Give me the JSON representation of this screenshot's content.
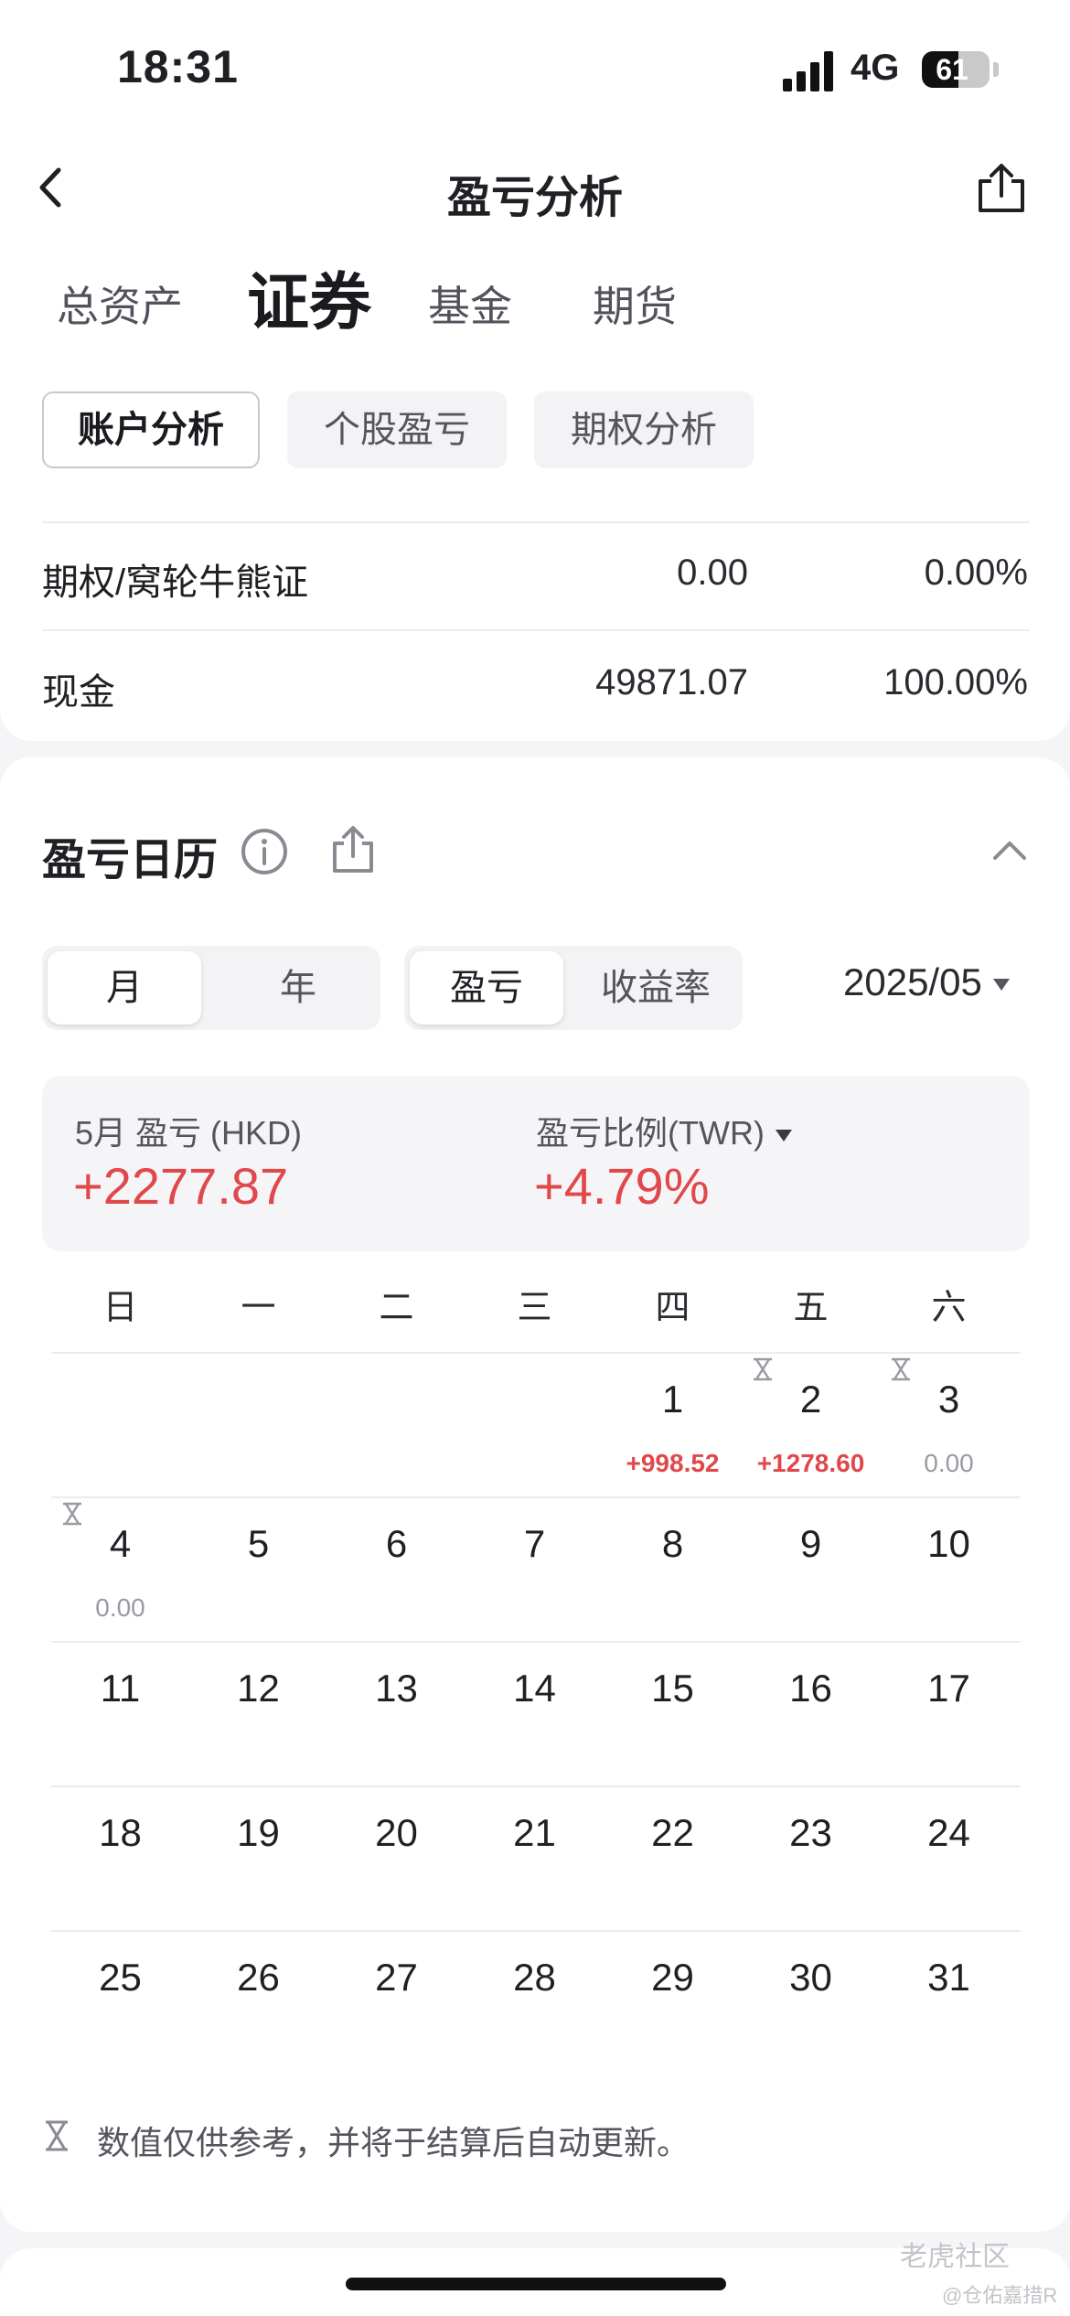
{
  "status_bar": {
    "time": "18:31",
    "network": "4G",
    "battery": "61",
    "battery_level": 0.61
  },
  "header": {
    "title": "盈亏分析"
  },
  "asset_tabs": [
    "总资产",
    "证券",
    "基金",
    "期货"
  ],
  "sub_tabs": [
    "账户分析",
    "个股盈亏",
    "期权分析"
  ],
  "holdings": [
    {
      "label": "期权/窝轮牛熊证",
      "amount": "0.00",
      "percent": "0.00%"
    },
    {
      "label": "现金",
      "amount": "49871.07",
      "percent": "100.00%"
    }
  ],
  "calendar": {
    "title": "盈亏日历",
    "period_toggle": [
      "月",
      "年"
    ],
    "metric_toggle": [
      "盈亏",
      "收益率"
    ],
    "date": "2025/05",
    "summary": {
      "pnl_label": "5月 盈亏 (HKD)",
      "pnl_value": "+2277.87",
      "ratio_label": "盈亏比例(TWR)",
      "ratio_value": "+4.79%"
    },
    "weekdays": [
      "日",
      "一",
      "二",
      "三",
      "四",
      "五",
      "六"
    ],
    "days": [
      "1",
      "2",
      "3",
      "4",
      "5",
      "6",
      "7",
      "8",
      "9",
      "10",
      "11",
      "12",
      "13",
      "14",
      "15",
      "16",
      "17",
      "18",
      "19",
      "20",
      "21",
      "22",
      "23",
      "24",
      "25",
      "26",
      "27",
      "28",
      "29",
      "30",
      "31"
    ],
    "daily_pnl": [
      {
        "day": "1",
        "value": "+998.52"
      },
      {
        "day": "2",
        "value": "+1278.60"
      },
      {
        "day": "3",
        "value": "0.00"
      },
      {
        "day": "4",
        "value": "0.00"
      }
    ],
    "note": "数值仅供参考，并将于结算后自动更新。"
  },
  "watermark": {
    "brand": "老虎社区",
    "user": "@仓佑嘉措R"
  },
  "colors": {
    "positive": "#e0484b",
    "neutral": "#9a9aa3",
    "text": "#1f1f24"
  },
  "icons": [
    "back-icon",
    "share-icon",
    "info-icon",
    "chevron-up-icon",
    "hourglass-icon",
    "dropdown-caret-icon"
  ]
}
